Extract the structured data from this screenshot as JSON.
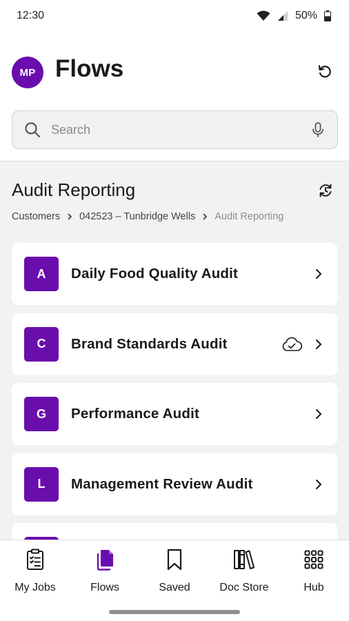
{
  "status_bar": {
    "time": "12:30",
    "battery": "50%"
  },
  "header": {
    "avatar_initials": "MP",
    "title": "Flows"
  },
  "search": {
    "placeholder": "Search"
  },
  "section": {
    "title": "Audit Reporting",
    "breadcrumb": [
      "Customers",
      "042523 – Tunbridge Wells",
      "Audit Reporting"
    ]
  },
  "cards": [
    {
      "letter": "A",
      "title": "Daily Food Quality Audit",
      "cloud": false
    },
    {
      "letter": "C",
      "title": "Brand Standards Audit",
      "cloud": true
    },
    {
      "letter": "G",
      "title": "Performance Audit",
      "cloud": false
    },
    {
      "letter": "L",
      "title": "Management Review Audit",
      "cloud": false
    },
    {
      "letter": "",
      "title": "",
      "cloud": false
    }
  ],
  "nav": [
    {
      "label": "My Jobs",
      "icon": "clipboard-icon"
    },
    {
      "label": "Flows",
      "icon": "documents-icon",
      "active": true
    },
    {
      "label": "Saved",
      "icon": "bookmark-icon"
    },
    {
      "label": "Doc Store",
      "icon": "library-icon"
    },
    {
      "label": "Hub",
      "icon": "grid-icon"
    }
  ],
  "colors": {
    "accent": "#6a0dad",
    "background": "#f2f2f2"
  }
}
